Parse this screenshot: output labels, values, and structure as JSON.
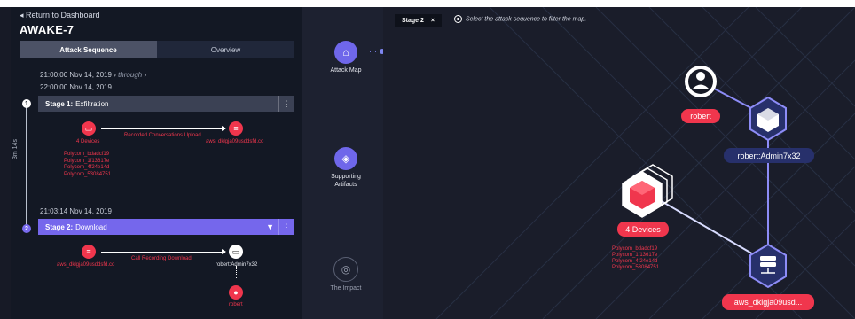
{
  "header": {
    "back_label": "◂ Return to Dashboard",
    "title": "AWAKE-7"
  },
  "tabs": [
    "Attack Sequence",
    "Overview"
  ],
  "timerange": {
    "start": "21:00:00  Nov 14, 2019",
    "through": "through",
    "end": "22:00:00  Nov 14, 2019"
  },
  "duration": "3m 14s",
  "stage1": {
    "num": "1",
    "prefix": "Stage 1:",
    "name": "Exfiltration",
    "source_label": "4 Devices",
    "edge_label": "Recorded Conversations Upload",
    "target_label": "aws_dklgja09usddsfd.co",
    "devices": [
      "Polycom_bdadcf19",
      "Polycom_1f13617e",
      "Polycom_4f24e14d",
      "Polycom_53084751"
    ]
  },
  "stage2": {
    "time": "21:03:14  Nov 14, 2019",
    "num": "2",
    "prefix": "Stage 2:",
    "name": "Download",
    "source_label": "aws_dklgja09usddsfd.co",
    "edge_label": "Call Recording Download",
    "target_label": "robert:Admin7x32",
    "user_label": "robert"
  },
  "sidebar_buttons": {
    "attack_map": "Attack Map",
    "artifacts": "Supporting Artifacts",
    "impact": "The Impact",
    "more": "···"
  },
  "map": {
    "chip_label": "Stage 2",
    "chip_close": "×",
    "hint": "Select the attack sequence to filter the map.",
    "nodes": {
      "user": "robert",
      "host": "robert:Admin7x32",
      "devices": "4 Devices",
      "server": "aws_dklgja09usd..."
    },
    "devices": [
      "Polycom_bdadcf19",
      "Polycom_1f13617e",
      "Polycom_4f24e14d",
      "Polycom_53084751"
    ]
  },
  "colors": {
    "accent": "#7567ec",
    "alert": "#f0364d",
    "node_navy": "#27306b",
    "edge": "#8d8cf7"
  }
}
